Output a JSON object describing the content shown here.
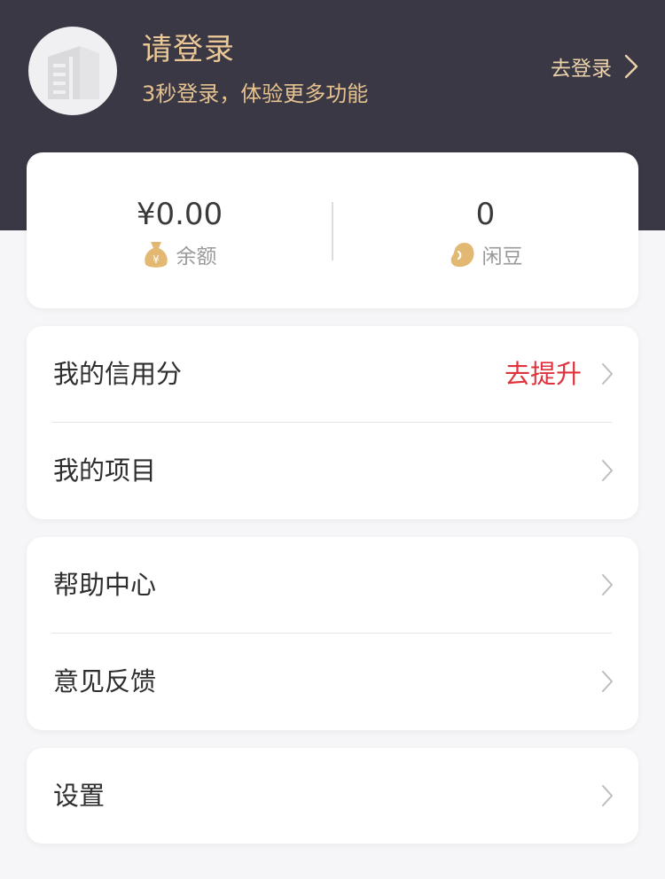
{
  "header": {
    "avatar_icon": "building-icon",
    "title": "请登录",
    "subtitle": "3秒登录，体验更多功能",
    "login_link": "去登录",
    "bg_color": "#3a3844",
    "accent_color": "#ecc896"
  },
  "stats": {
    "balance": {
      "value": "¥0.00",
      "label": "余额",
      "icon": "money-bag-icon"
    },
    "beans": {
      "value": "0",
      "label": "闲豆",
      "icon": "bean-icon"
    }
  },
  "menu": {
    "credit": {
      "label": "我的信用分",
      "action": "去提升",
      "action_color": "#e0323c"
    },
    "projects": {
      "label": "我的项目"
    },
    "help": {
      "label": "帮助中心"
    },
    "feedback": {
      "label": "意见反馈"
    },
    "settings": {
      "label": "设置"
    }
  }
}
